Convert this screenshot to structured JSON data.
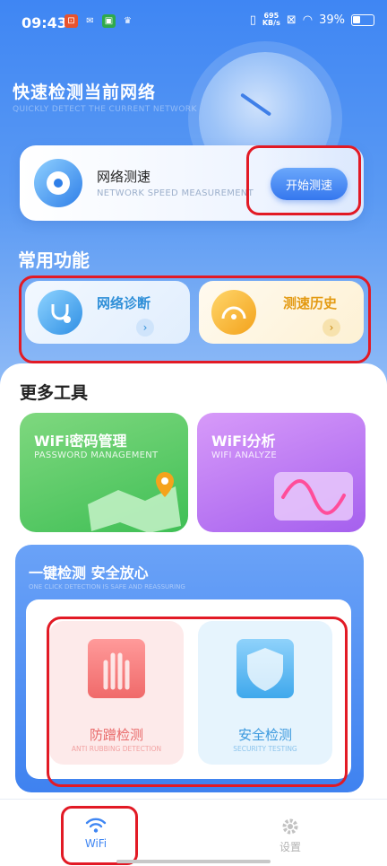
{
  "status_bar": {
    "time": "09:43",
    "net_speed_top": "695",
    "net_speed_unit": "KB/s",
    "battery": "39%"
  },
  "hero": {
    "title": "快速检测当前网络",
    "subtitle": "QUICKLY DETECT THE CURRENT NETWORK"
  },
  "speed_card": {
    "title": "网络测速",
    "subtitle": "NETWORK SPEED MEASUREMENT",
    "button": "开始测速"
  },
  "common": {
    "title": "常用功能",
    "items": [
      {
        "label": "网络诊断",
        "icon": "stethoscope-icon",
        "color": "#2f8fd8"
      },
      {
        "label": "测速历史",
        "icon": "speedometer-icon",
        "color": "#e39a12"
      }
    ]
  },
  "more_tools": {
    "title": "更多工具",
    "items": [
      {
        "label": "WiFi密码管理",
        "sub": "PASSWORD MANAGEMENT",
        "icon": "map-pin-icon"
      },
      {
        "label": "WiFi分析",
        "sub": "WIFI ANALYZE",
        "icon": "waveform-icon"
      }
    ]
  },
  "security": {
    "title": "一键检测 安全放心",
    "subtitle": "ONE CLICK DETECTION IS SAFE AND REASSURING",
    "items": [
      {
        "label": "防蹭检测",
        "sub": "ANTI RUBBING DETECTION",
        "icon": "hand-scan-icon"
      },
      {
        "label": "安全检测",
        "sub": "SECURITY TESTING",
        "icon": "shield-scan-icon"
      }
    ]
  },
  "nav": {
    "items": [
      {
        "label": "WiFi",
        "icon": "wifi-icon",
        "active": true
      },
      {
        "label": "设置",
        "icon": "gear-icon",
        "active": false
      }
    ]
  },
  "colors": {
    "primary": "#3f86f3",
    "highlight": "#e21a25"
  }
}
